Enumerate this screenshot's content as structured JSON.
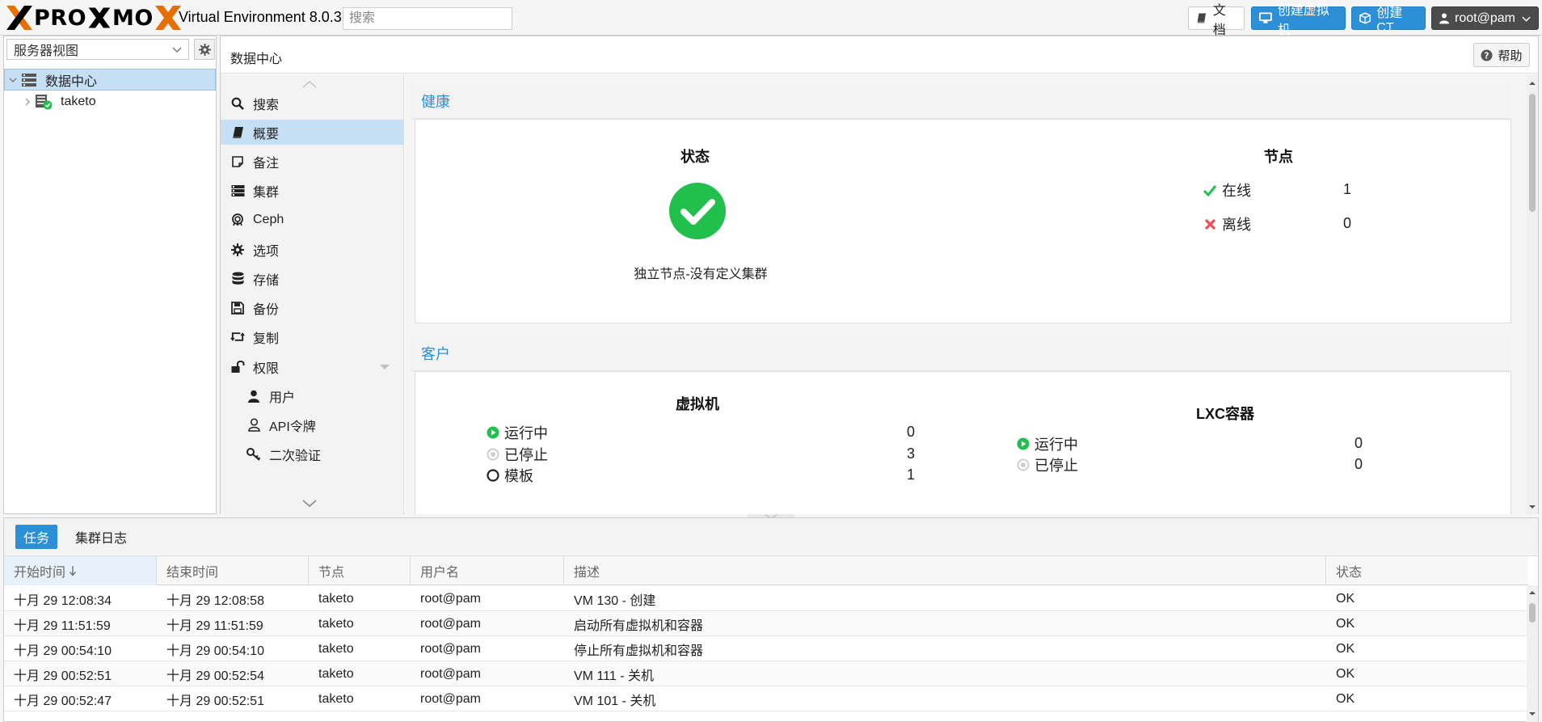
{
  "topbar": {
    "logo_part1": "PRO",
    "logo_part2": "MO",
    "product_name": "Virtual Environment 8.0.3",
    "search_placeholder": "搜索",
    "docs_label": "文档",
    "create_vm_label": "创建虚拟机",
    "create_ct_label": "创建CT",
    "user_label": "root@pam"
  },
  "sidebar": {
    "view_selector": "服务器视图",
    "tree": [
      {
        "label": "数据中心",
        "icon": "datacenter-icon"
      },
      {
        "label": "taketo",
        "icon": "node-online-icon"
      }
    ]
  },
  "content": {
    "breadcrumb": "数据中心",
    "help_label": "帮助",
    "menu": [
      {
        "label": "搜索",
        "icon": "search-icon",
        "active": false,
        "sub": false
      },
      {
        "label": "概要",
        "icon": "book-icon",
        "active": true,
        "sub": false
      },
      {
        "label": "备注",
        "icon": "note-icon",
        "active": false,
        "sub": false
      },
      {
        "label": "集群",
        "icon": "server-icon",
        "active": false,
        "sub": false
      },
      {
        "label": "Ceph",
        "icon": "ceph-icon",
        "active": false,
        "sub": false
      },
      {
        "label": "选项",
        "icon": "gear-icon",
        "active": false,
        "sub": false
      },
      {
        "label": "存储",
        "icon": "database-icon",
        "active": false,
        "sub": false
      },
      {
        "label": "备份",
        "icon": "save-icon",
        "active": false,
        "sub": false
      },
      {
        "label": "复制",
        "icon": "retweet-icon",
        "active": false,
        "sub": false
      },
      {
        "label": "权限",
        "icon": "unlock-icon",
        "active": false,
        "sub": false
      },
      {
        "label": "用户",
        "icon": "user-icon",
        "active": false,
        "sub": true
      },
      {
        "label": "API令牌",
        "icon": "user-outline-icon",
        "active": false,
        "sub": true
      },
      {
        "label": "二次验证",
        "icon": "key-icon",
        "active": false,
        "sub": true
      }
    ],
    "health": {
      "title": "健康",
      "status_title": "状态",
      "status_text": "独立节点-没有定义集群",
      "nodes_title": "节点",
      "online_label": "在线",
      "online_count": "1",
      "offline_label": "离线",
      "offline_count": "0"
    },
    "guests": {
      "title": "客户",
      "vm_title": "虚拟机",
      "vm_running_label": "运行中",
      "vm_running": "0",
      "vm_stopped_label": "已停止",
      "vm_stopped": "3",
      "vm_template_label": "模板",
      "vm_template": "1",
      "lxc_title": "LXC容器",
      "lxc_running_label": "运行中",
      "lxc_running": "0",
      "lxc_stopped_label": "已停止",
      "lxc_stopped": "0"
    }
  },
  "log": {
    "tabs": [
      "任务",
      "集群日志"
    ],
    "columns": [
      "开始时间",
      "结束时间",
      "节点",
      "用户名",
      "描述",
      "状态"
    ],
    "rows": [
      [
        "十月 29 12:08:34",
        "十月 29 12:08:58",
        "taketo",
        "root@pam",
        "VM 130 - 创建",
        "OK"
      ],
      [
        "十月 29 11:51:59",
        "十月 29 11:51:59",
        "taketo",
        "root@pam",
        "启动所有虚拟机和容器",
        "OK"
      ],
      [
        "十月 29 00:54:10",
        "十月 29 00:54:10",
        "taketo",
        "root@pam",
        "停止所有虚拟机和容器",
        "OK"
      ],
      [
        "十月 29 00:52:51",
        "十月 29 00:52:54",
        "taketo",
        "root@pam",
        "VM 111 - 关机",
        "OK"
      ],
      [
        "十月 29 00:52:47",
        "十月 29 00:52:51",
        "taketo",
        "root@pam",
        "VM 101 - 关机",
        "OK"
      ]
    ]
  },
  "colors": {
    "accent": "#2d8fd6",
    "logo_orange": "#e57000",
    "ok_green": "#21bf4b",
    "error_red": "#e4535b",
    "selected_bg": "#c7dff5"
  }
}
